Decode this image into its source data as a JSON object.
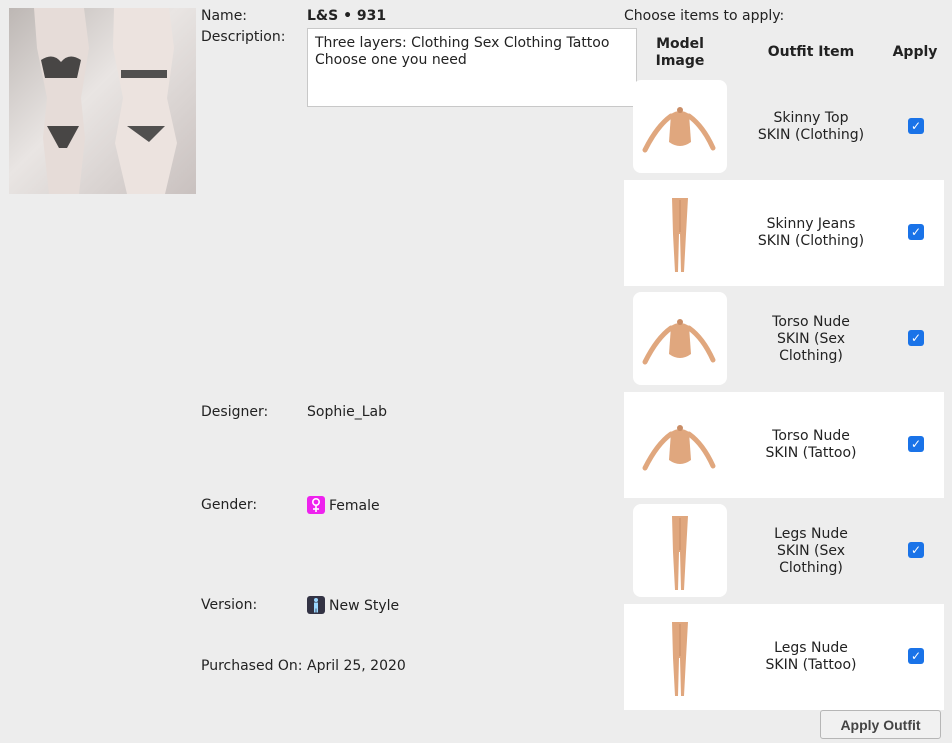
{
  "outfit": {
    "name_label": "Name:",
    "name": "L&S • 931",
    "description_label": "Description:",
    "description": "Three layers: Clothing Sex Clothing Tattoo\nChoose one you need",
    "designer_label": "Designer:",
    "designer": "Sophie_Lab",
    "gender_label": "Gender:",
    "gender": "Female",
    "gender_icon": "female-icon",
    "version_label": "Version:",
    "version": "New Style",
    "version_icon": "avatar-icon",
    "purchased_label": "Purchased On:",
    "purchased": "April 25, 2020"
  },
  "items_panel": {
    "title": "Choose items to apply:",
    "col_model_image": "Model\nImage",
    "col_outfit_item": "Outfit Item",
    "col_apply": "Apply",
    "items": [
      {
        "line1": "Skinny Top",
        "line2": "SKIN (Clothing)",
        "kind": "torso",
        "checked": true
      },
      {
        "line1": "Skinny Jeans",
        "line2": "SKIN (Clothing)",
        "kind": "legs",
        "checked": true
      },
      {
        "line1": "Torso Nude",
        "line2": "SKIN (Sex\nClothing)",
        "kind": "torso",
        "checked": true
      },
      {
        "line1": "Torso Nude",
        "line2": "SKIN (Tattoo)",
        "kind": "torso",
        "checked": true
      },
      {
        "line1": "Legs Nude",
        "line2": "SKIN (Sex\nClothing)",
        "kind": "legs",
        "checked": true
      },
      {
        "line1": "Legs Nude",
        "line2": "SKIN (Tattoo)",
        "kind": "legs",
        "checked": true
      }
    ],
    "apply_button": "Apply Outfit"
  },
  "colors": {
    "checkbox": "#1a73e8",
    "female_badge": "#ee22ee",
    "skin": "#e0a77e"
  }
}
